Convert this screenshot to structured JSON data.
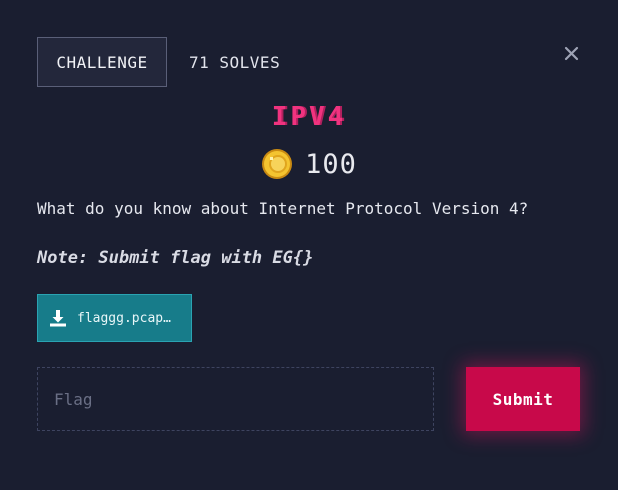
{
  "tabs": {
    "challenge_label": "CHALLENGE",
    "solves_label": "71 SOLVES"
  },
  "close": {
    "icon": "close-icon"
  },
  "challenge": {
    "title": "IPV4",
    "points": "100",
    "points_icon": "coin-icon",
    "description": "What do you know about Internet Protocol Version 4?",
    "note": "Note: Submit flag with EG{}"
  },
  "file": {
    "icon": "download-icon",
    "name": "flaggg.pcap…"
  },
  "flag_form": {
    "placeholder": "Flag",
    "value": "",
    "submit_label": "Submit"
  },
  "colors": {
    "background": "#1a1e30",
    "title": "#f0337f",
    "file_button": "#177c8a",
    "submit_button": "#c8094a"
  }
}
